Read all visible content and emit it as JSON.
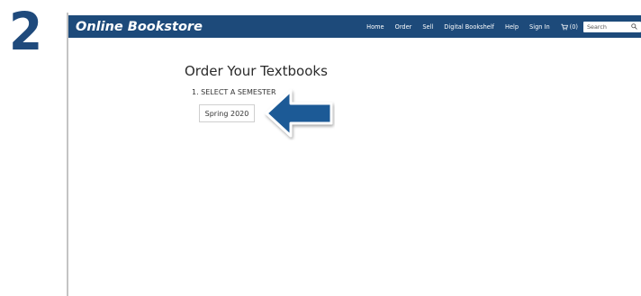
{
  "step_number": "2",
  "header": {
    "brand": "Online Bookstore",
    "nav": [
      "Home",
      "Order",
      "Sell",
      "Digital Bookshelf",
      "Help",
      "Sign In"
    ],
    "cart_count": "(0)",
    "search_placeholder": "Search"
  },
  "main": {
    "title": "Order Your Textbooks",
    "step_label": "1. SELECT A SEMESTER",
    "semester_option": "Spring 2020"
  },
  "colors": {
    "brand_blue": "#1d4a7a",
    "step_number_blue": "#1f4a7c",
    "arrow_blue": "#1f5a96"
  },
  "icons": [
    "cart-icon",
    "search-icon",
    "arrow-left-icon"
  ]
}
